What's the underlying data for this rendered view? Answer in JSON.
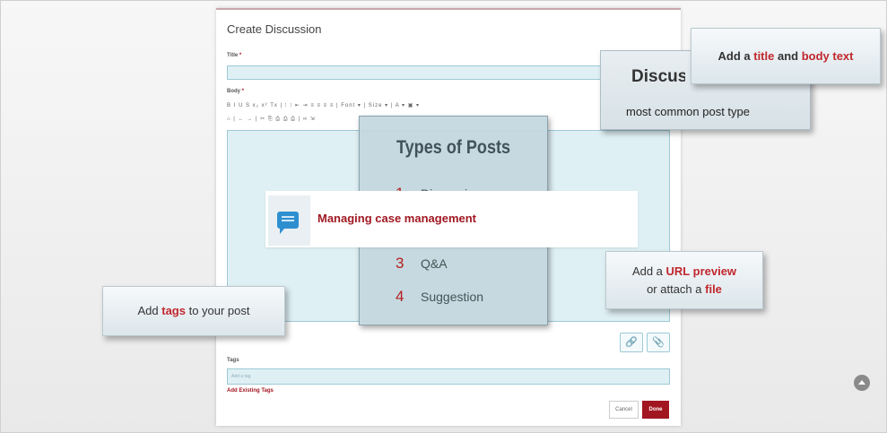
{
  "form": {
    "heading": "Create Discussion",
    "title_label": "Title",
    "required_mark": "*",
    "body_label": "Body",
    "toolbar_row1": "B I U S x₂ x² Tx | ⁝ ⁝ ⇤ ⇥ ≡ ≡ ≡ ≡ | Font ▾ | Size ▾ | A ▾ ▣ ▾",
    "toolbar_row2": "⌂ | ← → | ✂ ⎘ ⎙ ⎙ ⎙ | ∞ ⇲",
    "tags_label": "Tags",
    "tags_placeholder": "Add a tag",
    "add_existing_tags": "Add Existing Tags",
    "cancel_label": "Cancel",
    "done_label": "Done",
    "link_icon": "link-icon",
    "attach_icon": "paperclip-icon"
  },
  "overlay": {
    "types_title": "Types of Posts",
    "types": [
      {
        "num": "1",
        "label": "Discussion"
      },
      {
        "num": "3",
        "label": "Q&A"
      },
      {
        "num": "4",
        "label": "Suggestion"
      }
    ],
    "ribbon_label": "Managing case management",
    "ribbon_icon": "chat-bubble-icon",
    "discussion_heading": "Discussion Posts",
    "discussion_sub": "most common post type",
    "callout_title": {
      "pre": "Add a ",
      "hl1": "title",
      "mid": " and ",
      "hl2": "body text"
    },
    "callout_url": {
      "pre": "Add a ",
      "hl1": "URL preview",
      "mid": "or attach a ",
      "hl2": "file"
    },
    "callout_tags": {
      "pre": "Add ",
      "hl": "tags",
      "post": " to your post"
    }
  },
  "colors": {
    "accent_red": "#a21620",
    "highlight_red": "#c0272d",
    "field_blue": "#dff0f4"
  }
}
